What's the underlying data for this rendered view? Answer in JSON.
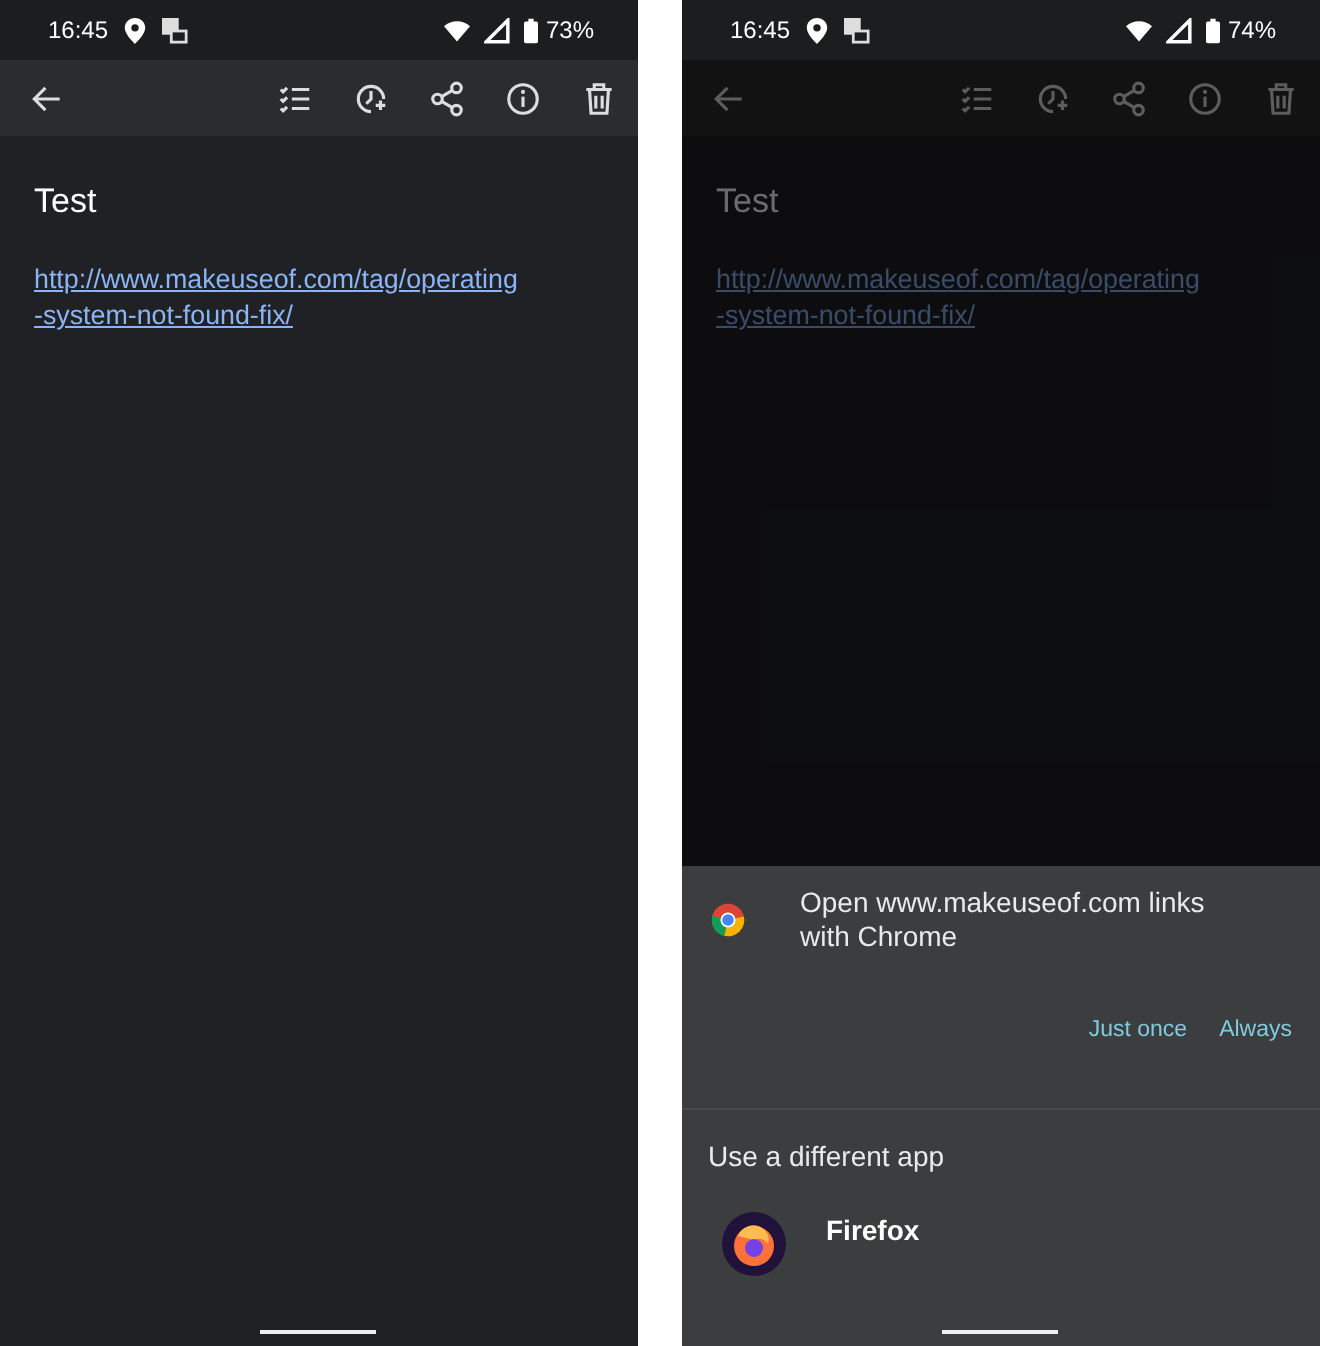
{
  "screens": [
    {
      "status": {
        "time": "16:45",
        "battery": "73%"
      },
      "note": {
        "title": "Test",
        "link": "http://www.makeuseof.com/tag/operating-system-not-found-fix/"
      },
      "dimmed": false
    },
    {
      "status": {
        "time": "16:45",
        "battery": "74%"
      },
      "note": {
        "title": "Test",
        "link": "http://www.makeuseof.com/tag/operating-system-not-found-fix/"
      },
      "dimmed": true,
      "sheet": {
        "message": "Open www.makeuseof.com links with Chrome",
        "buttons": [
          "Just once",
          "Always"
        ],
        "section": "Use a different app",
        "apps": [
          {
            "name": "Firefox"
          }
        ]
      }
    }
  ]
}
